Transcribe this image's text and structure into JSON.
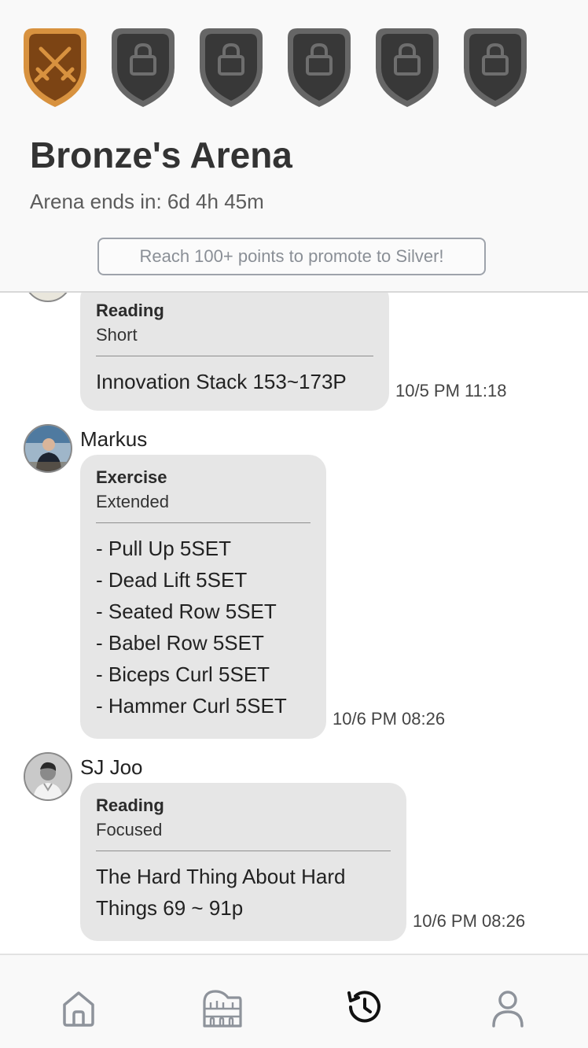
{
  "header": {
    "title": "Bronze's Arena",
    "ends_label": "Arena ends in:",
    "ends_value": "6d 4h 45m",
    "promo_text": "Reach 100+ points to promote to Silver!",
    "badges": [
      {
        "icon": "crossed-swords-icon",
        "state": "active",
        "color": "#c97a2b"
      },
      {
        "icon": "lock-icon",
        "state": "locked",
        "color": "#3a3a3a"
      },
      {
        "icon": "lock-icon",
        "state": "locked",
        "color": "#3a3a3a"
      },
      {
        "icon": "lock-icon",
        "state": "locked",
        "color": "#3a3a3a"
      },
      {
        "icon": "lock-icon",
        "state": "locked",
        "color": "#3a3a3a"
      },
      {
        "icon": "lock-icon",
        "state": "locked",
        "color": "#3a3a3a"
      }
    ]
  },
  "feed": {
    "posts": [
      {
        "user": "",
        "category": "Reading",
        "level": "Short",
        "content": "Innovation Stack 153~173P",
        "time": "10/5 PM 11:18"
      },
      {
        "user": "Markus",
        "category": "Exercise",
        "level": "Extended",
        "content": "- Pull Up 5SET\n- Dead Lift 5SET\n- Seated Row 5SET\n- Babel Row 5SET\n- Biceps Curl 5SET\n- Hammer Curl 5SET",
        "time": "10/6 PM 08:26"
      },
      {
        "user": "SJ Joo",
        "category": "Reading",
        "level": "Focused",
        "content": "The Hard Thing About Hard\nThings 69 ~ 91p",
        "time": "10/6 PM 08:26"
      }
    ]
  },
  "tabbar": {
    "tabs": [
      {
        "icon": "home-icon",
        "active": false
      },
      {
        "icon": "colosseum-icon",
        "active": false
      },
      {
        "icon": "history-icon",
        "active": true
      },
      {
        "icon": "profile-icon",
        "active": false
      }
    ],
    "active_color": "#111111",
    "inactive_color": "#8e939b"
  }
}
